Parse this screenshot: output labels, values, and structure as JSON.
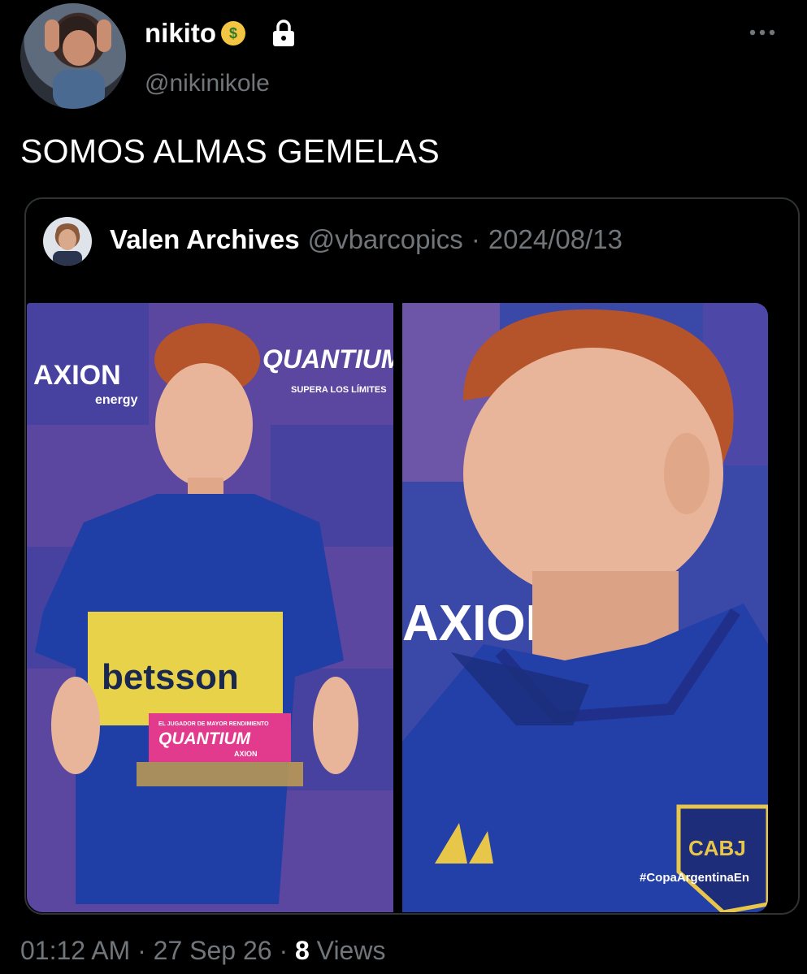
{
  "tweet": {
    "display_name": "nikito",
    "handle": "@nikinikole",
    "text": "SOMOS ALMAS GEMELAS",
    "time": "01:12 AM",
    "date": "27 Sep 26",
    "views_count": "8",
    "views_label": "Views"
  },
  "quote": {
    "display_name": "Valen Archives",
    "handle": "@vbarcopics",
    "date": "2024/08/13"
  },
  "photo_left": {
    "brand_a": "AXION",
    "brand_a_sub": "energy",
    "brand_b": "QUANTIUM",
    "brand_b_sub": "SUPERA LOS LÍMITES",
    "shirt_text": "betsson",
    "trophy_caption": "EL JUGADOR DE MAYOR RENDIMIENTO",
    "trophy_title": "QUANTIUM",
    "trophy_sub": "AXION"
  },
  "photo_right": {
    "brand": "AXION",
    "crest": "CABJ",
    "hashtag": "#CopaArgentinaEn"
  },
  "icons": [
    "money-mouth-emoji",
    "lock-icon",
    "more-icon"
  ],
  "colors": {
    "background": "#000000",
    "muted": "#71767b",
    "border": "#2f3336"
  }
}
